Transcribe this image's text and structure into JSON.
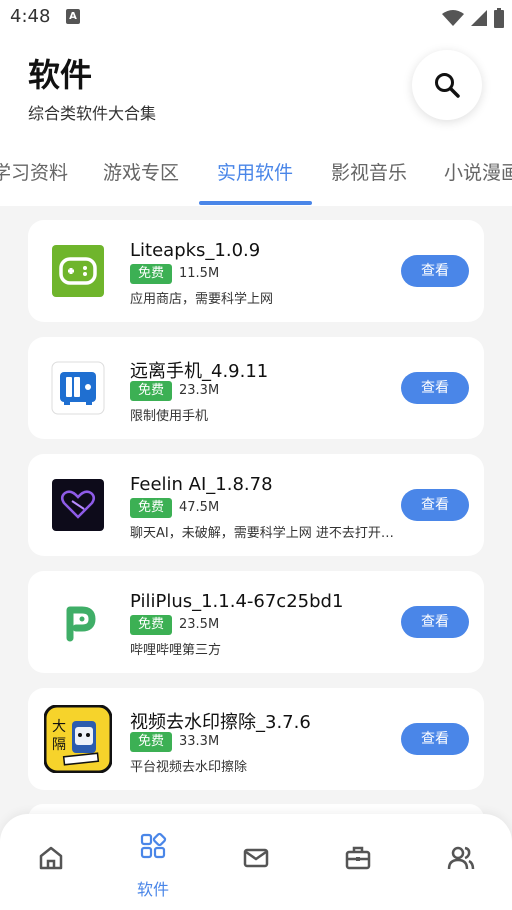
{
  "status_bar": {
    "time": "4:48",
    "notification_glyph": "A",
    "icons": [
      "wifi-icon",
      "signal-icon",
      "battery-icon"
    ]
  },
  "header": {
    "title": "软件",
    "subtitle": "综合类软件大合集",
    "search_icon": "search-icon"
  },
  "tabs": [
    {
      "label": "学习资料",
      "active": false
    },
    {
      "label": "游戏专区",
      "active": false
    },
    {
      "label": "实用软件",
      "active": true
    },
    {
      "label": "影视音乐",
      "active": false
    },
    {
      "label": "小说漫画",
      "active": false
    }
  ],
  "apps": [
    {
      "name": "Liteapks_1.0.9",
      "badge": "免费",
      "size": "11.5M",
      "desc": "应用商店，需要科学上网",
      "button": "查看",
      "icon": "gamepad-icon"
    },
    {
      "name": "远离手机_4.9.11",
      "badge": "免费",
      "size": "23.3M",
      "desc": "限制使用手机",
      "button": "查看",
      "icon": "phone-safe-icon"
    },
    {
      "name": "Feelin AI_1.8.78",
      "badge": "免费",
      "size": "47.5M",
      "desc": "聊天AI，未破解，需要科学上网 进不去打开应用",
      "button": "查看",
      "icon": "heart-ai-icon"
    },
    {
      "name": "PiliPlus_1.1.4-67c25bd1",
      "badge": "免费",
      "size": "23.5M",
      "desc": "哔哩哔哩第三方",
      "button": "查看",
      "icon": "piliplus-logo-icon"
    },
    {
      "name": "视频去水印擦除_3.7.6",
      "badge": "免费",
      "size": "33.3M",
      "desc": "平台视频去水印擦除",
      "button": "查看",
      "icon": "watermark-eraser-icon"
    }
  ],
  "bottom_nav": [
    {
      "icon": "home-icon",
      "label": "",
      "active": false
    },
    {
      "icon": "apps-grid-icon",
      "label": "软件",
      "active": true
    },
    {
      "icon": "mail-icon",
      "label": "",
      "active": false
    },
    {
      "icon": "toolbox-icon",
      "label": "",
      "active": false
    },
    {
      "icon": "users-icon",
      "label": "",
      "active": false
    }
  ],
  "colors": {
    "accent": "#4a86e8",
    "free_badge": "#3cb054",
    "background": "#f4f4f4"
  }
}
